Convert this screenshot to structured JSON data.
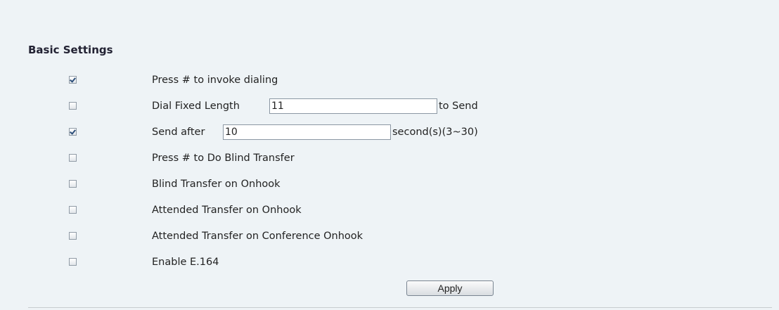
{
  "section_title": "Basic Settings",
  "settings": [
    {
      "label": "Press # to invoke dialing",
      "checked": true
    },
    {
      "label": "Dial Fixed Length",
      "checked": false,
      "input_value": "11",
      "suffix": "to Send"
    },
    {
      "label": "Send after",
      "checked": true,
      "input_value": "10",
      "suffix": "second(s)(3~30)"
    },
    {
      "label": "Press # to Do Blind Transfer",
      "checked": false
    },
    {
      "label": "Blind Transfer on Onhook",
      "checked": false
    },
    {
      "label": "Attended Transfer on Onhook",
      "checked": false
    },
    {
      "label": "Attended Transfer on Conference Onhook",
      "checked": false
    },
    {
      "label": "Enable E.164",
      "checked": false
    }
  ],
  "apply_label": "Apply"
}
